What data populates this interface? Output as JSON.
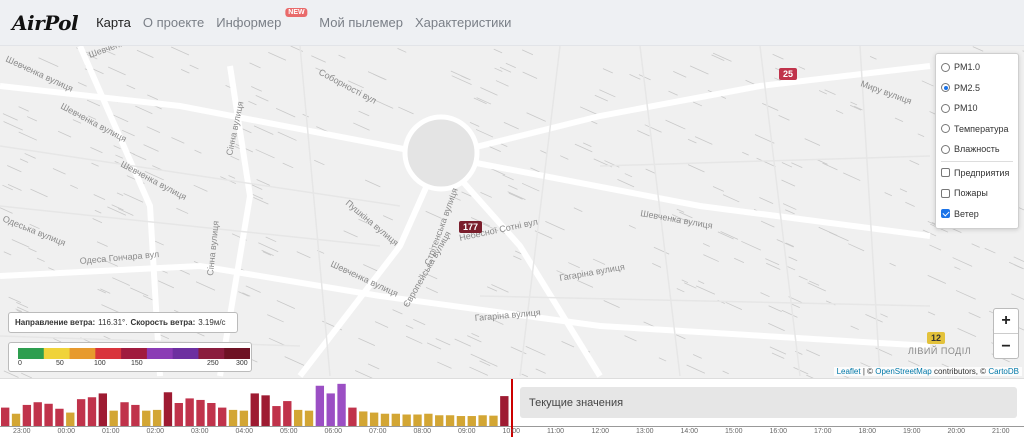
{
  "header": {
    "brand": "AirPol",
    "nav": [
      {
        "label": "Карта",
        "active": true
      },
      {
        "label": "О проекте",
        "active": false
      },
      {
        "label": "Информер",
        "active": false,
        "badge": "NEW"
      },
      {
        "label": "Мой пылемер",
        "active": false
      },
      {
        "label": "Характеристики",
        "active": false
      }
    ]
  },
  "map": {
    "streets": [
      "Шевченка вулиця",
      "Шевченка вулиця",
      "Шевченка вулиця",
      "Шевченка вулиця",
      "Соборності вул",
      "Сінна вулиця",
      "Сінна вулиця",
      "Одеська вулиця",
      "Одеса Гончара вул",
      "Пушкіна вулиця",
      "Європейська вулиця",
      "Стрітенська вулиця",
      "Гагаріна вулиця",
      "Небесної Сотні вул",
      "Шевченка вулиця",
      "Шевченка вулиця",
      "Гагаріна вулиця",
      "Миру вулиця"
    ],
    "markers": [
      {
        "value": "25",
        "color": "#c0334b"
      },
      {
        "value": "177",
        "color": "#7a1e2c"
      },
      {
        "value": "12",
        "color": "#e3c23b"
      }
    ],
    "district": "ЛІВИЙ ПОДІЛ"
  },
  "layers": {
    "radios": [
      {
        "label": "PM1.0",
        "checked": false
      },
      {
        "label": "PM2.5",
        "checked": true
      },
      {
        "label": "PM10",
        "checked": false
      },
      {
        "label": "Температура",
        "checked": false
      },
      {
        "label": "Влажность",
        "checked": false
      }
    ],
    "checkboxes": [
      {
        "label": "Предприятия",
        "checked": false
      },
      {
        "label": "Пожары",
        "checked": false
      },
      {
        "label": "Ветер",
        "checked": true
      }
    ]
  },
  "zoom": {
    "in": "+",
    "out": "−"
  },
  "wind": {
    "direction_label": "Направление ветра:",
    "direction_value": "116.31°.",
    "speed_label": "Скорость ветра:",
    "speed_value": "3.19м/с"
  },
  "legend": {
    "ticks": [
      "0",
      "50",
      "100",
      "150",
      "250",
      "300"
    ],
    "colors": [
      "#2e9e4f",
      "#f0d33a",
      "#e79a2e",
      "#d9343b",
      "#a01b3e",
      "#8b3bb5",
      "#6d2fa0",
      "#8a1c3e",
      "#6e1224"
    ]
  },
  "attribution": {
    "leaflet": "Leaflet",
    "sep1": " | © ",
    "osm": "OpenStreetMap",
    "contributors": " contributors, © ",
    "carto": "CartoDB"
  },
  "timeline": {
    "current_label": "Текущие значения",
    "hours": [
      "23:00",
      "00:00",
      "01:00",
      "02:00",
      "03:00",
      "04:00",
      "05:00",
      "06:00",
      "07:00",
      "08:00",
      "09:00",
      "10:00",
      "11:00",
      "12:00",
      "13:00",
      "14:00",
      "15:00",
      "16:00",
      "17:00",
      "18:00",
      "19:00",
      "20:00",
      "21:00"
    ],
    "bars": [
      {
        "v": 48,
        "c": "#c0334b"
      },
      {
        "v": 32,
        "c": "#d3a634"
      },
      {
        "v": 55,
        "c": "#c0334b"
      },
      {
        "v": 62,
        "c": "#c0334b"
      },
      {
        "v": 58,
        "c": "#c0334b"
      },
      {
        "v": 45,
        "c": "#c0334b"
      },
      {
        "v": 35,
        "c": "#d3a634"
      },
      {
        "v": 70,
        "c": "#c0334b"
      },
      {
        "v": 75,
        "c": "#c0334b"
      },
      {
        "v": 85,
        "c": "#9e1b32"
      },
      {
        "v": 40,
        "c": "#d3a634"
      },
      {
        "v": 62,
        "c": "#c0334b"
      },
      {
        "v": 55,
        "c": "#c0334b"
      },
      {
        "v": 40,
        "c": "#d3a634"
      },
      {
        "v": 42,
        "c": "#d3a634"
      },
      {
        "v": 88,
        "c": "#9e1b32"
      },
      {
        "v": 60,
        "c": "#c0334b"
      },
      {
        "v": 72,
        "c": "#c0334b"
      },
      {
        "v": 68,
        "c": "#c0334b"
      },
      {
        "v": 60,
        "c": "#c0334b"
      },
      {
        "v": 48,
        "c": "#c0334b"
      },
      {
        "v": 42,
        "c": "#d3a634"
      },
      {
        "v": 40,
        "c": "#d3a634"
      },
      {
        "v": 85,
        "c": "#9e1b32"
      },
      {
        "v": 80,
        "c": "#9e1b32"
      },
      {
        "v": 52,
        "c": "#c0334b"
      },
      {
        "v": 65,
        "c": "#c0334b"
      },
      {
        "v": 42,
        "c": "#d3a634"
      },
      {
        "v": 40,
        "c": "#d3a634"
      },
      {
        "v": 105,
        "c": "#9b4fc4"
      },
      {
        "v": 85,
        "c": "#9b4fc4"
      },
      {
        "v": 110,
        "c": "#9b4fc4"
      },
      {
        "v": 48,
        "c": "#c0334b"
      },
      {
        "v": 38,
        "c": "#d3a634"
      },
      {
        "v": 35,
        "c": "#d3a634"
      },
      {
        "v": 32,
        "c": "#d3a634"
      },
      {
        "v": 32,
        "c": "#d3a634"
      },
      {
        "v": 30,
        "c": "#d3a634"
      },
      {
        "v": 30,
        "c": "#d3a634"
      },
      {
        "v": 32,
        "c": "#d3a634"
      },
      {
        "v": 28,
        "c": "#d3a634"
      },
      {
        "v": 28,
        "c": "#d3a634"
      },
      {
        "v": 26,
        "c": "#d3a634"
      },
      {
        "v": 26,
        "c": "#d3a634"
      },
      {
        "v": 28,
        "c": "#d3a634"
      },
      {
        "v": 27,
        "c": "#d3a634"
      },
      {
        "v": 78,
        "c": "#9e1b32"
      }
    ]
  }
}
